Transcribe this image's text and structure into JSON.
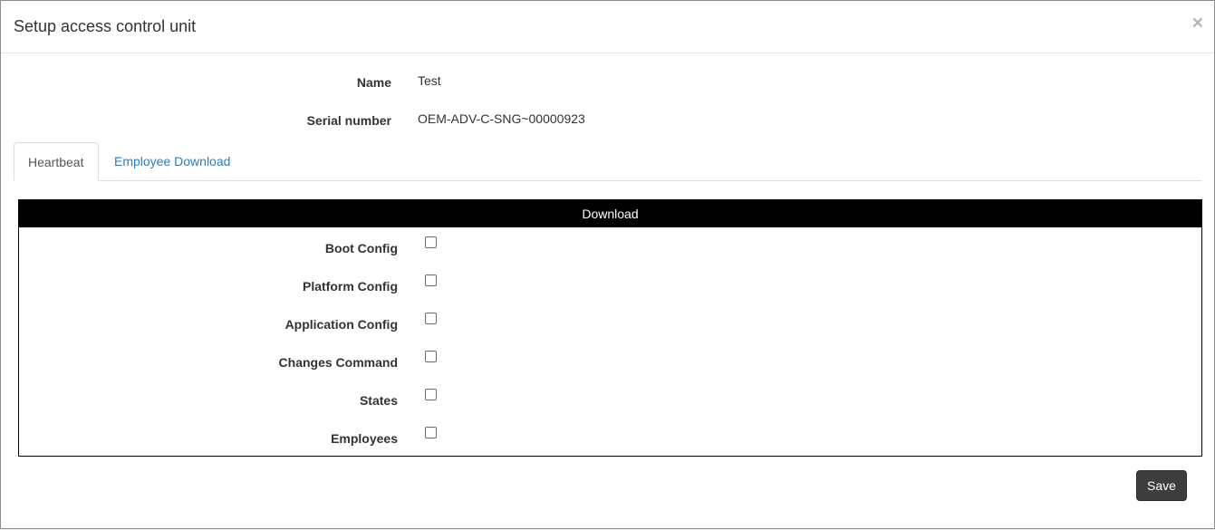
{
  "modal": {
    "title": "Setup access control unit",
    "close_glyph": "×"
  },
  "info": {
    "name_label": "Name",
    "name_value": "Test",
    "serial_label": "Serial number",
    "serial_value": "OEM-ADV-C-SNG~00000923"
  },
  "tabs": [
    {
      "label": "Heartbeat",
      "active": true
    },
    {
      "label": "Employee Download",
      "active": false
    }
  ],
  "download_panel": {
    "header": "Download",
    "items": [
      {
        "label": "Boot Config",
        "checked": false
      },
      {
        "label": "Platform Config",
        "checked": false
      },
      {
        "label": "Application Config",
        "checked": false
      },
      {
        "label": "Changes Command",
        "checked": false
      },
      {
        "label": "States",
        "checked": false
      },
      {
        "label": "Employees",
        "checked": false
      }
    ]
  },
  "footer": {
    "save_label": "Save"
  },
  "colors": {
    "panel_header_bg": "#000000",
    "link": "#337ab7",
    "save_button_bg": "#3d3d3d"
  }
}
